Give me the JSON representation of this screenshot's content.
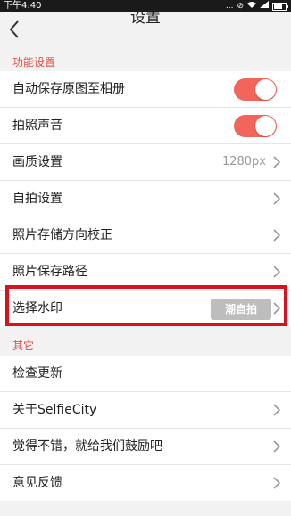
{
  "status_bar": {
    "time": "下午4:40",
    "signal_text": "...",
    "wifi_icon": "wifi-icon"
  },
  "header": {
    "title": "设置"
  },
  "section_features": {
    "title": "功能设置",
    "items": [
      {
        "label": "自动保存原图至相册",
        "toggle_on": true
      },
      {
        "label": "拍照声音",
        "toggle_on": true
      },
      {
        "label": "画质设置",
        "value": "1280px"
      },
      {
        "label": "自拍设置"
      },
      {
        "label": "照片存储方向校正"
      },
      {
        "label": "照片保存路径"
      },
      {
        "label": "选择水印",
        "badge": "潮自拍"
      }
    ]
  },
  "section_other": {
    "title": "其它",
    "items": [
      {
        "label": "检查更新"
      },
      {
        "label": "关于SelfieCity"
      },
      {
        "label": "觉得不错，就给我们鼓励吧"
      },
      {
        "label": "意见反馈"
      }
    ]
  },
  "colors": {
    "accent": "#e2524a",
    "toggle": "#f3645a",
    "highlight": "#d9131b"
  }
}
